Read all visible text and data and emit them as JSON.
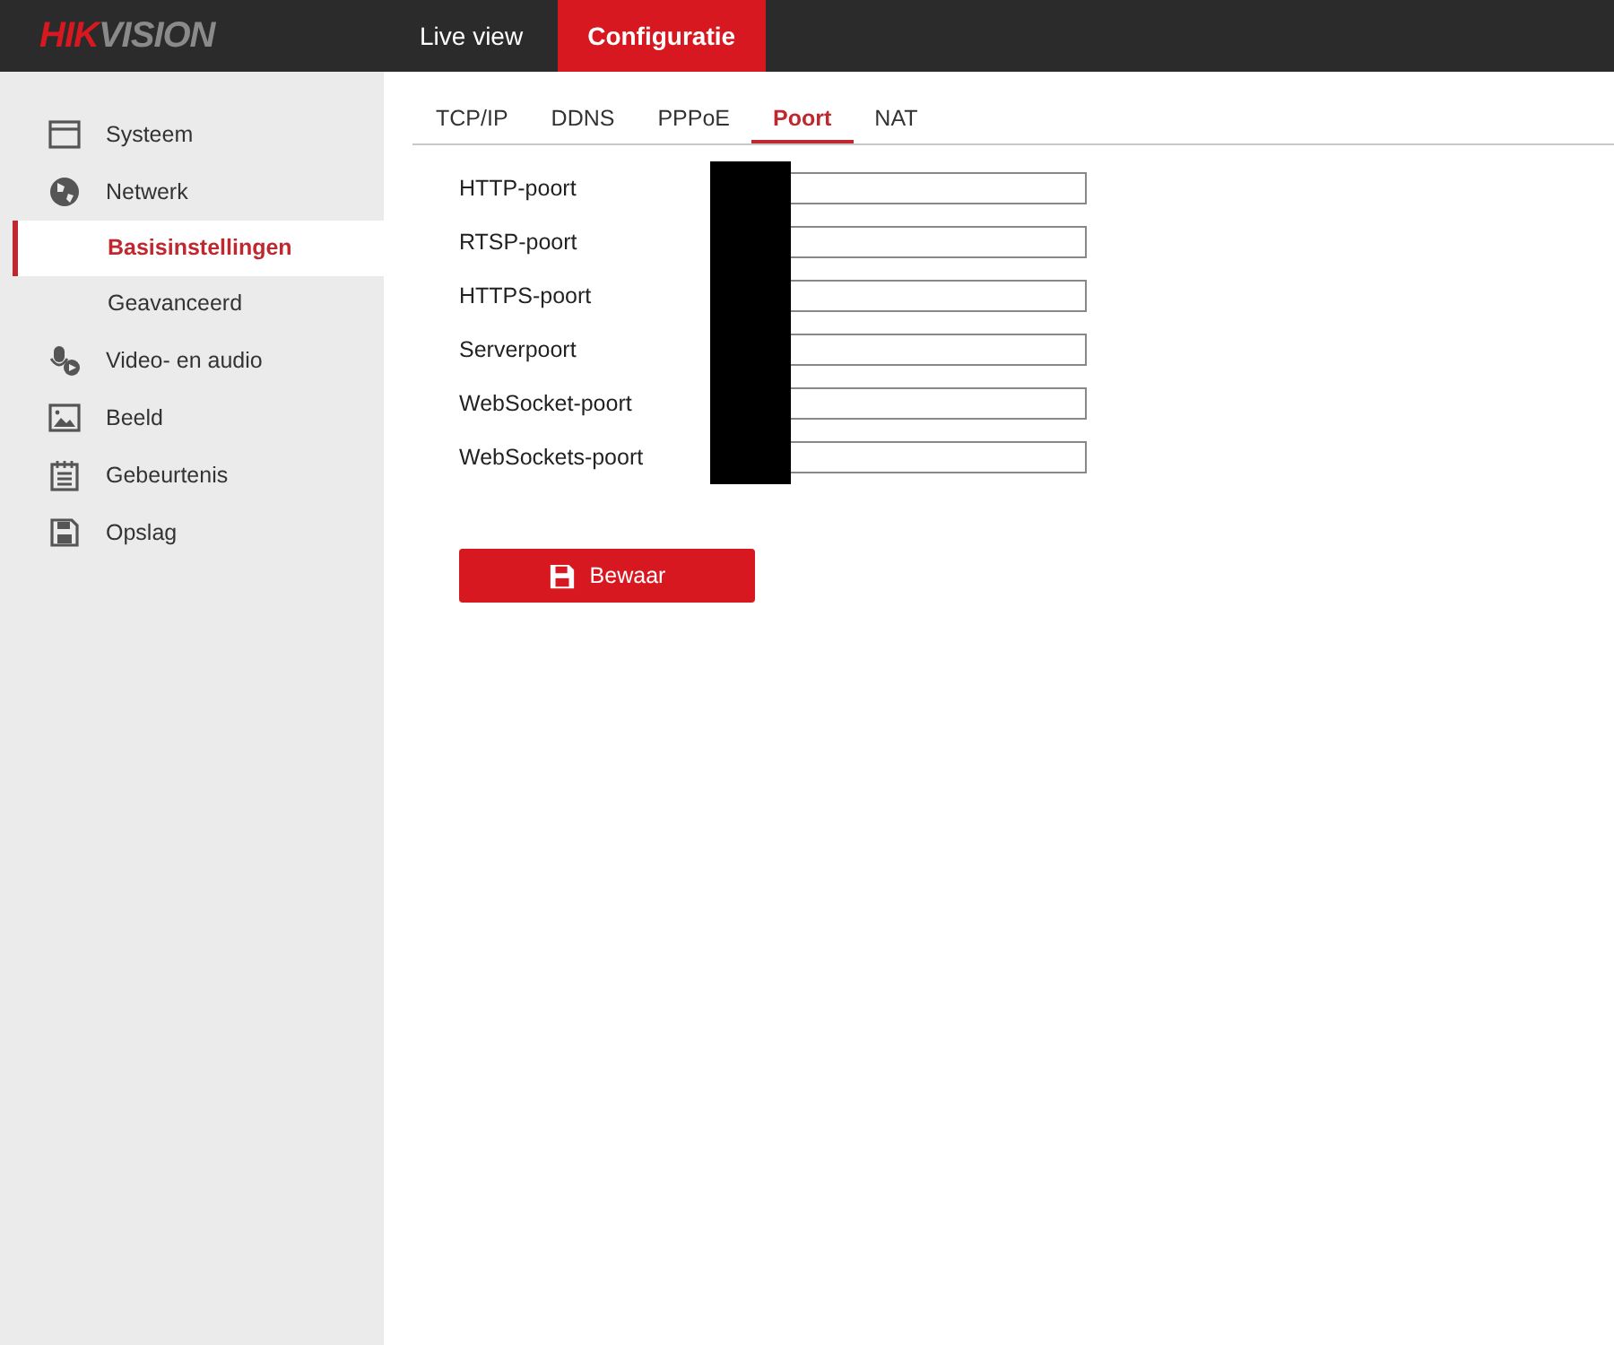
{
  "logo": {
    "part_1": "HIK",
    "part_2": "VISION"
  },
  "top_nav": [
    {
      "label": "Live view",
      "selected": false
    },
    {
      "label": "Configuratie",
      "selected": true
    }
  ],
  "sidebar": {
    "items": [
      {
        "label": "Systeem",
        "selected": false
      },
      {
        "label": "Netwerk",
        "selected": false,
        "children": [
          {
            "label": "Basisinstellingen",
            "selected": true
          },
          {
            "label": "Geavanceerd",
            "selected": false
          }
        ]
      },
      {
        "label": "Video- en audio",
        "selected": false
      },
      {
        "label": "Beeld",
        "selected": false
      },
      {
        "label": "Gebeurtenis",
        "selected": false
      },
      {
        "label": "Opslag",
        "selected": false
      }
    ]
  },
  "tabs": [
    {
      "label": "TCP/IP",
      "selected": false
    },
    {
      "label": "DDNS",
      "selected": false
    },
    {
      "label": "PPPoE",
      "selected": false
    },
    {
      "label": "Poort",
      "selected": true
    },
    {
      "label": "NAT",
      "selected": false
    }
  ],
  "form": {
    "fields": [
      {
        "label": "HTTP-poort"
      },
      {
        "label": "RTSP-poort"
      },
      {
        "label": "HTTPS-poort"
      },
      {
        "label": "Serverpoort"
      },
      {
        "label": "WebSocket-poort"
      },
      {
        "label": "WebSockets-poort"
      }
    ]
  },
  "save_button": {
    "label": "Bewaar"
  }
}
